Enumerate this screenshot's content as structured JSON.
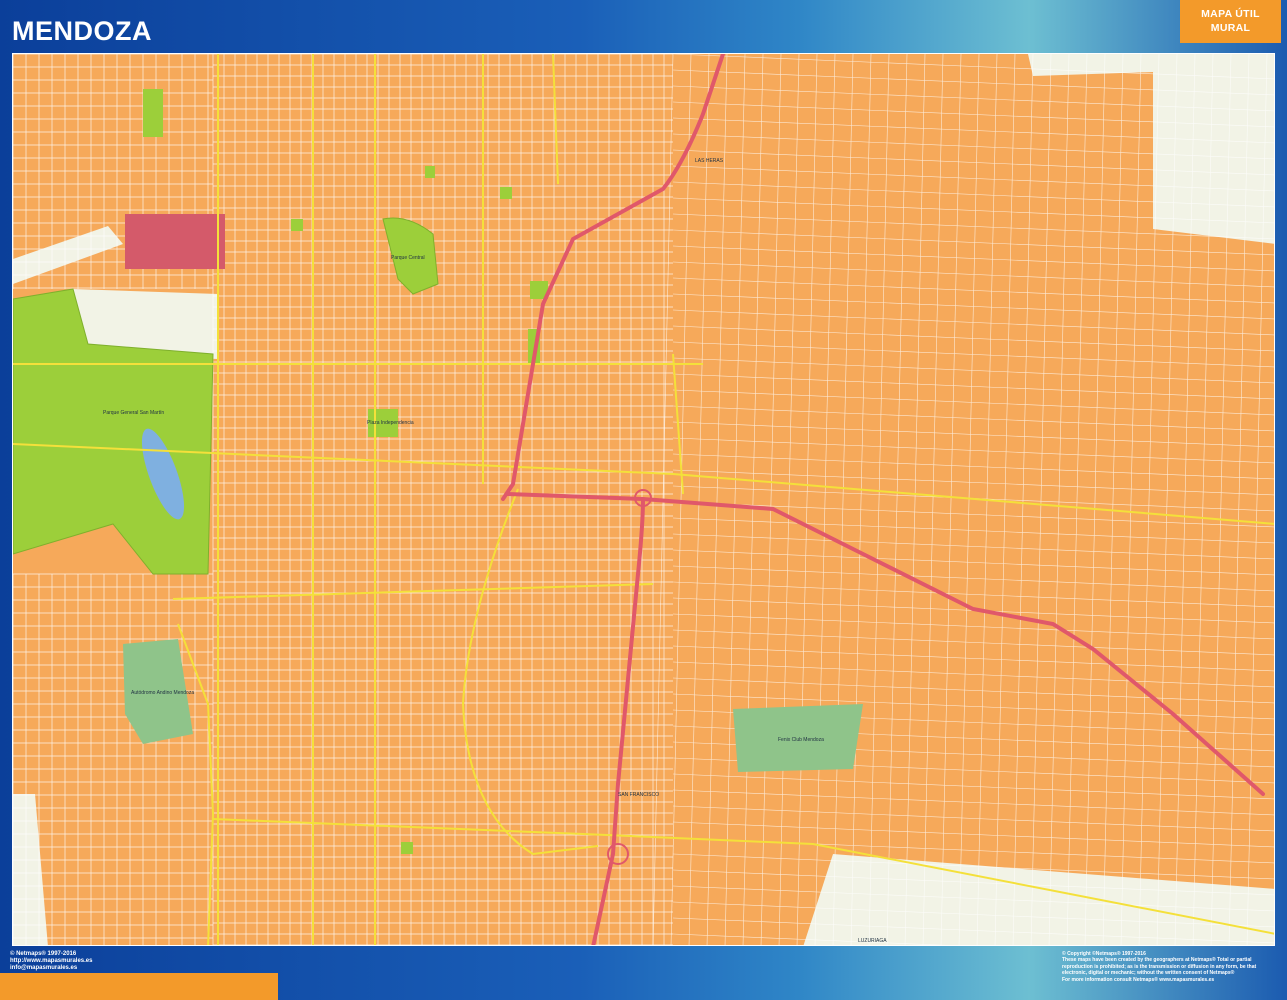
{
  "title": "MENDOZA",
  "badge": {
    "line1": "MAPA ÚTIL",
    "line2": "MURAL"
  },
  "footer_left": {
    "copyright": "© Netmaps® 1997-2016",
    "url": "http://www.mapasmurales.es",
    "email": "info@mapasmurales.es"
  },
  "footer_right": {
    "line1": "© Copyright ©Netmaps® 1997-2016",
    "line2": "These maps have been created by the geographers at Netmaps® Total or partial",
    "line3": "reproduction is prohibited; as is the transmission or diffusion in any form, be that",
    "line4": "electronic, digital or mechanic; without the written consent of Netmaps®",
    "line5": "For more information consult Netmaps® www.mapasmurales.es"
  },
  "map_labels": {
    "parque_general": "Parque General San Martín",
    "parque_central": "Parque Central",
    "plaza": "Plaza Independencia",
    "autodromo": "Autódromo Andino Mendoza",
    "country_club": "Fenix Club Mendoza",
    "las_heras": "LAS HERAS",
    "san_francisco": "SAN FRANCISCO",
    "luzuriaga": "LUZURIAGA"
  },
  "colors": {
    "frame_blue": "#0d4aa6",
    "urban": "#f6a95a",
    "park": "#9ccf3a",
    "park_pale": "#8fc48a",
    "highway": "#e0586a",
    "main_road": "#f4e03a",
    "street": "#ffffff",
    "rural": "#f2f3e6",
    "accent_orange": "#f39a2a"
  }
}
